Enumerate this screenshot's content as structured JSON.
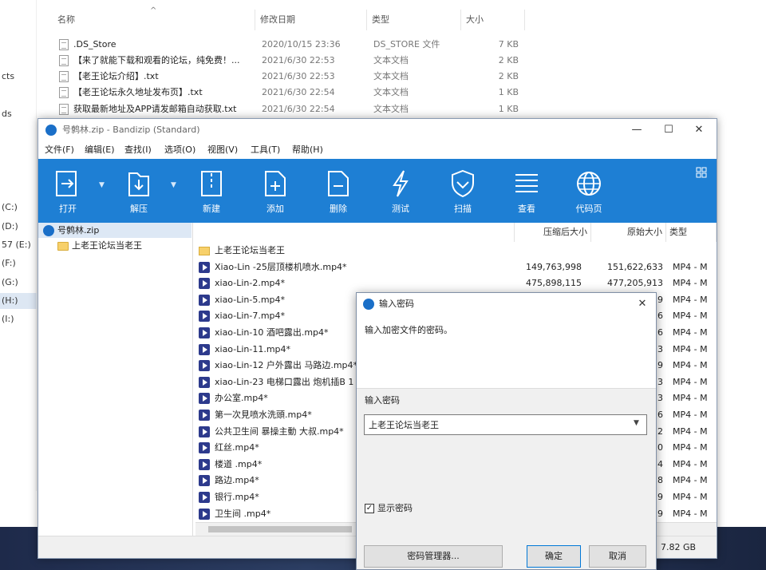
{
  "explorer": {
    "nav_items": [
      {
        "label": "cts",
        "selected": false
      },
      {
        "label": "ds",
        "selected": false
      },
      {
        "label": "(C:)",
        "selected": false
      },
      {
        "label": "(D:)",
        "selected": false
      },
      {
        "label": "57 (E:)",
        "selected": false
      },
      {
        "label": "(F:)",
        "selected": false
      },
      {
        "label": "(G:)",
        "selected": false
      },
      {
        "label": "(H:)",
        "selected": true
      },
      {
        "label": "(I:)",
        "selected": false
      }
    ],
    "columns": {
      "name": "名称",
      "date": "修改日期",
      "type": "类型",
      "size": "大小"
    },
    "files": [
      {
        "name": ".DS_Store",
        "date": "2020/10/15 23:36",
        "type": "DS_STORE 文件",
        "size": "7 KB"
      },
      {
        "name": "【来了就能下载和观看的论坛，纯免费！...",
        "date": "2021/6/30 22:53",
        "type": "文本文档",
        "size": "2 KB"
      },
      {
        "name": "【老王论坛介绍】.txt",
        "date": "2021/6/30 22:53",
        "type": "文本文档",
        "size": "2 KB"
      },
      {
        "name": "【老王论坛永久地址发布页】.txt",
        "date": "2021/6/30 22:54",
        "type": "文本文档",
        "size": "1 KB"
      },
      {
        "name": "获取最新地址及APP请发邮箱自动获取.txt",
        "date": "2021/6/30 22:54",
        "type": "文本文档",
        "size": "1 KB"
      }
    ]
  },
  "bandizip": {
    "title": "号鹩林.zip - Bandizip (Standard)",
    "menu": [
      "文件(F)",
      "编辑(E)",
      "查找(I)",
      "选项(O)",
      "视图(V)",
      "工具(T)",
      "帮助(H)"
    ],
    "toolbar": [
      "打开",
      "解压",
      "新建",
      "添加",
      "删除",
      "测试",
      "扫描",
      "查看",
      "代码页"
    ],
    "toolbar_color": "#1e7fd4",
    "tree": {
      "root": "号鹩林.zip",
      "child": "上老王论坛当老王"
    },
    "list_columns": {
      "name": "",
      "compressed": "压缩后大小",
      "original": "原始大小",
      "type": "类型"
    },
    "rows": [
      {
        "kind": "folder",
        "name": "上老王论坛当老王",
        "compressed": "",
        "original": "",
        "type": ""
      },
      {
        "kind": "video",
        "name": "Xiao-Lin -25层顶楼机喷水.mp4*",
        "compressed": "149,763,998",
        "original": "151,622,633",
        "type": "MP4 - M"
      },
      {
        "kind": "video",
        "name": "xiao-Lin-2.mp4*",
        "compressed": "475,898,115",
        "original": "477,205,913",
        "type": "MP4 - M"
      },
      {
        "kind": "video",
        "name": "xiao-Lin-5.mp4*",
        "compressed": "",
        "original": "9",
        "type": "MP4 - M"
      },
      {
        "kind": "video",
        "name": "xiao-Lin-7.mp4*",
        "compressed": "",
        "original": "6",
        "type": "MP4 - M"
      },
      {
        "kind": "video",
        "name": "xiao-Lin-10 酒吧露出.mp4*",
        "compressed": "",
        "original": "6",
        "type": "MP4 - M"
      },
      {
        "kind": "video",
        "name": "xiao-Lin-11.mp4*",
        "compressed": "",
        "original": "3",
        "type": "MP4 - M"
      },
      {
        "kind": "video",
        "name": "xiao-Lin-12 户外露出 马路边.mp4*",
        "compressed": "",
        "original": "9",
        "type": "MP4 - M"
      },
      {
        "kind": "video",
        "name": "xiao-Lin-23 电梯口露出 炮机插B 1",
        "compressed": "",
        "original": "3",
        "type": "MP4 - M"
      },
      {
        "kind": "video",
        "name": "办公室.mp4*",
        "compressed": "",
        "original": "3",
        "type": "MP4 - M"
      },
      {
        "kind": "video",
        "name": "第一次見喷水洗頭.mp4*",
        "compressed": "",
        "original": "6",
        "type": "MP4 - M"
      },
      {
        "kind": "video",
        "name": "公共卫生间 暴操主動 大叔.mp4*",
        "compressed": "",
        "original": "2",
        "type": "MP4 - M"
      },
      {
        "kind": "video",
        "name": "红丝.mp4*",
        "compressed": "",
        "original": "0",
        "type": "MP4 - M"
      },
      {
        "kind": "video",
        "name": "楼道 .mp4*",
        "compressed": "",
        "original": "4",
        "type": "MP4 - M"
      },
      {
        "kind": "video",
        "name": "路边.mp4*",
        "compressed": "",
        "original": "8",
        "type": "MP4 - M"
      },
      {
        "kind": "video",
        "name": "银行.mp4*",
        "compressed": "",
        "original": "9",
        "type": "MP4 - M"
      },
      {
        "kind": "video",
        "name": "卫生间 .mp4*",
        "compressed": "",
        "original": "9",
        "type": "MP4 - M"
      }
    ],
    "status": "7.82 GB"
  },
  "dialog": {
    "title": "输入密码",
    "message": "输入加密文件的密码。",
    "label": "输入密码",
    "password": "上老王论坛当老王",
    "show_password": "显示密码",
    "buttons": {
      "manager": "密码管理器...",
      "ok": "确定",
      "cancel": "取消"
    }
  }
}
